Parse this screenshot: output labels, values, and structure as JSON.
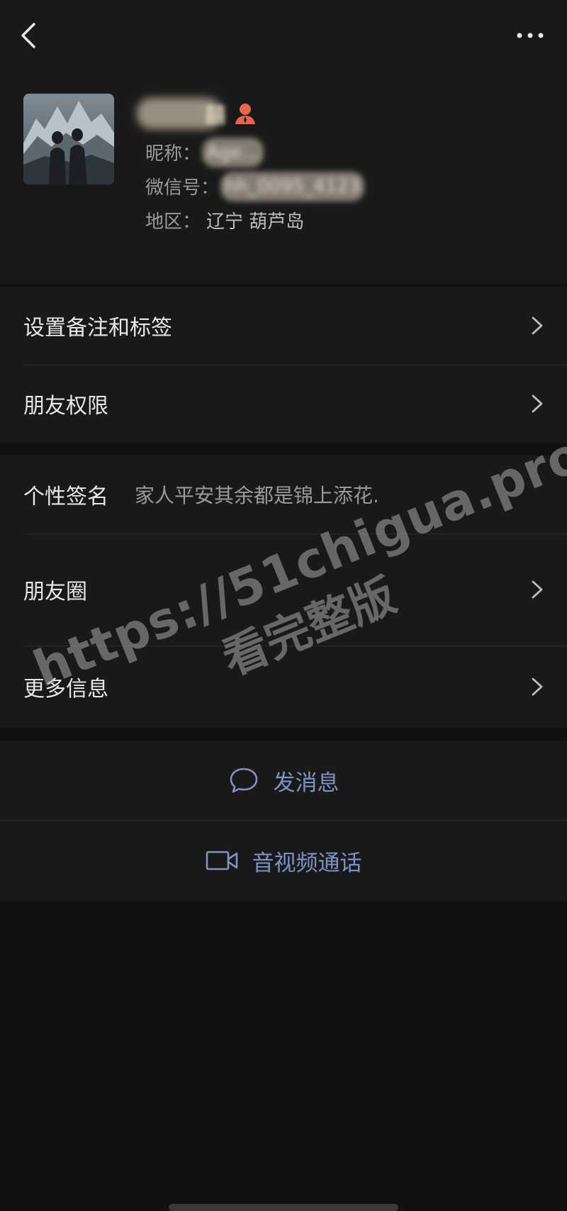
{
  "header": {
    "back_icon": "chevron-left-icon",
    "more_icon": "more-dots-icon"
  },
  "profile": {
    "name_visible_glyph": "囍",
    "nickname_label": "昵称：",
    "nickname_value": "Age...",
    "wechat_id_label": "微信号：",
    "wechat_id_value": "hh_0095_4123",
    "region_label": "地区：",
    "region_value": "辽宁  葫芦岛",
    "star_friend_icon": "person-star-icon",
    "star_color": "#e8674a"
  },
  "settings": {
    "remark_tags_label": "设置备注和标签",
    "friend_permissions_label": "朋友权限"
  },
  "details": {
    "signature_label": "个性签名",
    "signature_value": "家人平安其余都是锦上添花.",
    "moments_label": "朋友圈",
    "more_info_label": "更多信息"
  },
  "actions": {
    "message_label": "发消息",
    "call_label": "音视频通话",
    "accent_color": "#7f93c2"
  },
  "watermark": {
    "url": "https://51chigua.pro",
    "subtitle": "看完整版"
  }
}
